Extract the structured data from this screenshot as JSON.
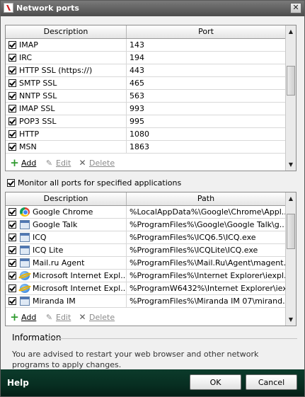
{
  "window": {
    "title": "Network ports"
  },
  "ports_table": {
    "headers": {
      "description": "Description",
      "port": "Port"
    },
    "rows": [
      {
        "description": "IMAP",
        "port": "143"
      },
      {
        "description": "IRC",
        "port": "194"
      },
      {
        "description": "HTTP SSL (https://)",
        "port": "443"
      },
      {
        "description": "SMTP SSL",
        "port": "465"
      },
      {
        "description": "NNTP SSL",
        "port": "563"
      },
      {
        "description": "IMAP SSL",
        "port": "993"
      },
      {
        "description": "POP3 SSL",
        "port": "995"
      },
      {
        "description": "HTTP",
        "port": "1080"
      },
      {
        "description": "MSN",
        "port": "1863"
      }
    ]
  },
  "ports_actions": {
    "add": "Add",
    "edit": "Edit",
    "delete": "Delete"
  },
  "monitor": {
    "label": "Monitor all ports for specified applications",
    "checked": true
  },
  "apps_table": {
    "headers": {
      "description": "Description",
      "path": "Path"
    },
    "rows": [
      {
        "description": "Google Chrome",
        "path": "%LocalAppData%\\Google\\Chrome\\Appl...",
        "icon": "chrome-icon"
      },
      {
        "description": "Google Talk",
        "path": "%ProgramFiles%\\Google\\Google Talk\\g...",
        "icon": "app-window-icon"
      },
      {
        "description": "ICQ",
        "path": "%ProgramFiles%\\ICQ6.5\\ICQ.exe",
        "icon": "app-window-icon"
      },
      {
        "description": "ICQ Lite",
        "path": "%ProgramFiles%\\ICQLite\\ICQ.exe",
        "icon": "app-window-icon"
      },
      {
        "description": "Mail.ru Agent",
        "path": "%ProgramFiles%\\Mail.Ru\\Agent\\magent...",
        "icon": "app-window-icon"
      },
      {
        "description": "Microsoft Internet Expl...",
        "path": "%ProgramFiles%\\Internet Explorer\\iexpl...",
        "icon": "internet-explorer-icon"
      },
      {
        "description": "Microsoft Internet Expl...",
        "path": "%ProgramW6432%\\Internet Explorer\\iex...",
        "icon": "internet-explorer-icon"
      },
      {
        "description": "Miranda IM",
        "path": "%ProgramFiles%\\Miranda IM 07\\mirand...",
        "icon": "app-window-icon"
      }
    ]
  },
  "apps_actions": {
    "add": "Add",
    "edit": "Edit",
    "delete": "Delete"
  },
  "info": {
    "title": "Information",
    "text": "You are advised to restart your web browser and other network programs to apply changes."
  },
  "footer": {
    "help": "Help",
    "ok": "OK",
    "cancel": "Cancel"
  },
  "colors": {
    "footer": "#072e21",
    "add_icon": "#2e9a2e"
  }
}
